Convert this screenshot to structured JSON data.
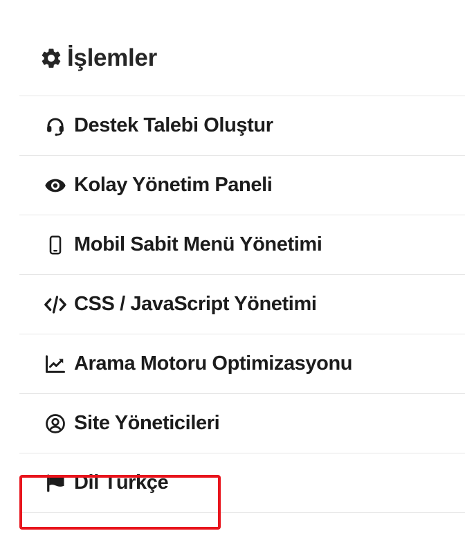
{
  "panel": {
    "title": "İşlemler",
    "title_icon": "gear-icon"
  },
  "menu": {
    "items": [
      {
        "label": "Destek Talebi Oluştur",
        "icon": "headset-icon"
      },
      {
        "label": "Kolay Yönetim Paneli",
        "icon": "eye-icon"
      },
      {
        "label": "Mobil Sabit Menü Yönetimi",
        "icon": "mobile-phone-icon"
      },
      {
        "label": "CSS / JavaScript Yönetimi",
        "icon": "code-icon"
      },
      {
        "label": "Arama Motoru Optimizasyonu",
        "icon": "chart-line-icon"
      },
      {
        "label": "Site Yöneticileri",
        "icon": "user-circle-icon"
      },
      {
        "label": "Dil Türkçe",
        "icon": "flag-icon"
      }
    ]
  },
  "highlight": {
    "target": "Dil Türkçe",
    "color": "#e8141c"
  },
  "colors": {
    "text": "#1c1c1c",
    "divider": "#e6e6e6",
    "background": "#ffffff"
  }
}
